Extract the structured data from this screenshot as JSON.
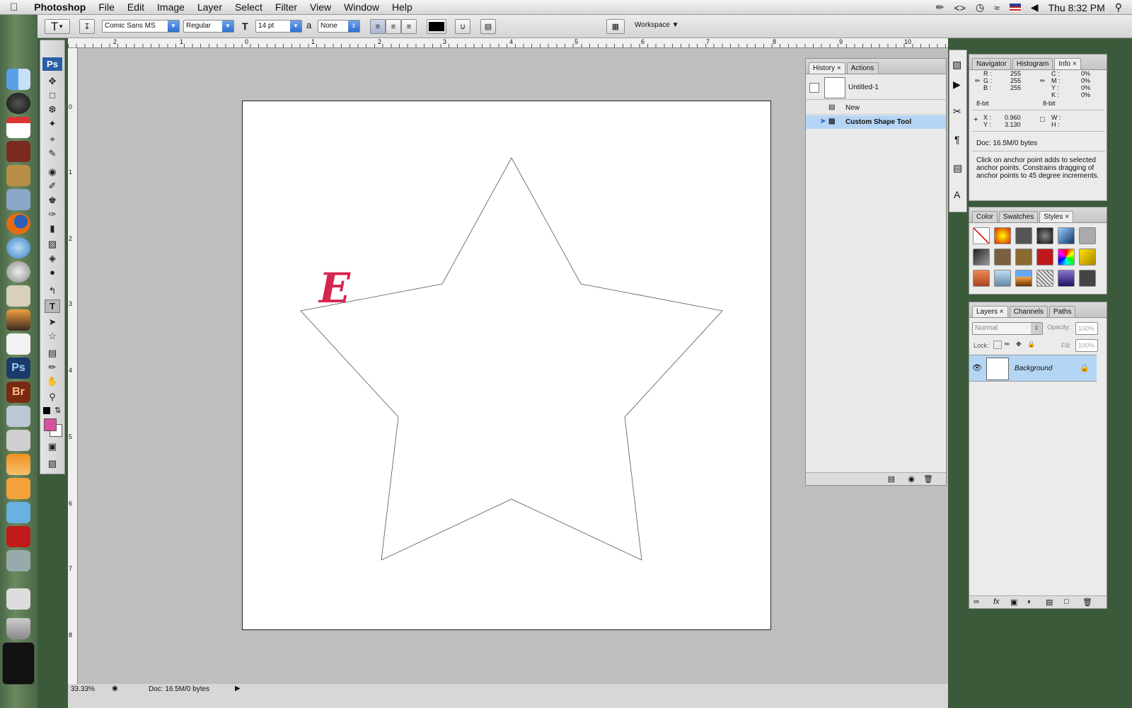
{
  "menubar": {
    "app_name": "Photoshop",
    "items": [
      "File",
      "Edit",
      "Image",
      "Layer",
      "Select",
      "Filter",
      "View",
      "Window",
      "Help"
    ],
    "clock": "Thu 8:32 PM",
    "icons": [
      "apple-icon",
      "script-icon",
      "code-icon",
      "time-machine-icon",
      "wifi-icon",
      "flag-icon",
      "volume-icon",
      "spotlight-icon"
    ]
  },
  "options": {
    "font_family": "Comic Sans MS",
    "font_style": "Regular",
    "font_size": "14 pt",
    "aa_label": "a",
    "antialias": "None",
    "workspace": "Workspace",
    "text_color": "#000000"
  },
  "document": {
    "zoom": "33.33%",
    "status": "Doc: 16.5M/0 bytes",
    "ruler_top_labels": [
      "2",
      "1",
      "0",
      "1",
      "2",
      "3",
      "4",
      "5",
      "6",
      "7",
      "8",
      "9",
      "10"
    ],
    "ruler_left_labels": [
      "0",
      "1",
      "2",
      "3",
      "4",
      "5",
      "6",
      "7",
      "8"
    ],
    "text_glyph": "E"
  },
  "history": {
    "tabs": [
      "History",
      "Actions"
    ],
    "snapshot": "Untitled-1",
    "items": [
      "New",
      "Custom Shape Tool"
    ]
  },
  "info": {
    "tabs": [
      "Navigator",
      "Histogram",
      "Info"
    ],
    "r_label": "R :",
    "r": "255",
    "g_label": "G :",
    "g": "255",
    "b_label": "B :",
    "b": "255",
    "c_label": "C :",
    "c": "0%",
    "m_label": "M :",
    "m": "0%",
    "y_label": "Y :",
    "y": "0%",
    "k_label": "K :",
    "k": "0%",
    "bit_left": "8-bit",
    "bit_right": "8-bit",
    "x_label": "X :",
    "x": "0.960",
    "ylab": "Y :",
    "yv": "3.130",
    "w_label": "W :",
    "h_label": "H :",
    "doc": "Doc: 16.5M/0 bytes",
    "hint": "Click on anchor point adds to selected anchor points. Constrains dragging of anchor points to 45 degree increments."
  },
  "styles": {
    "tabs": [
      "Color",
      "Swatches",
      "Styles"
    ]
  },
  "layers": {
    "tabs": [
      "Layers",
      "Channels",
      "Paths"
    ],
    "blend": "Normal",
    "opacity_label": "Opacity:",
    "opacity": "100%",
    "lock_label": "Lock:",
    "fill_label": "Fill:",
    "fill": "100%",
    "layer_name": "Background"
  },
  "colors": {
    "foreground": "#d94fa0",
    "text_glyph": "#d6274f"
  }
}
